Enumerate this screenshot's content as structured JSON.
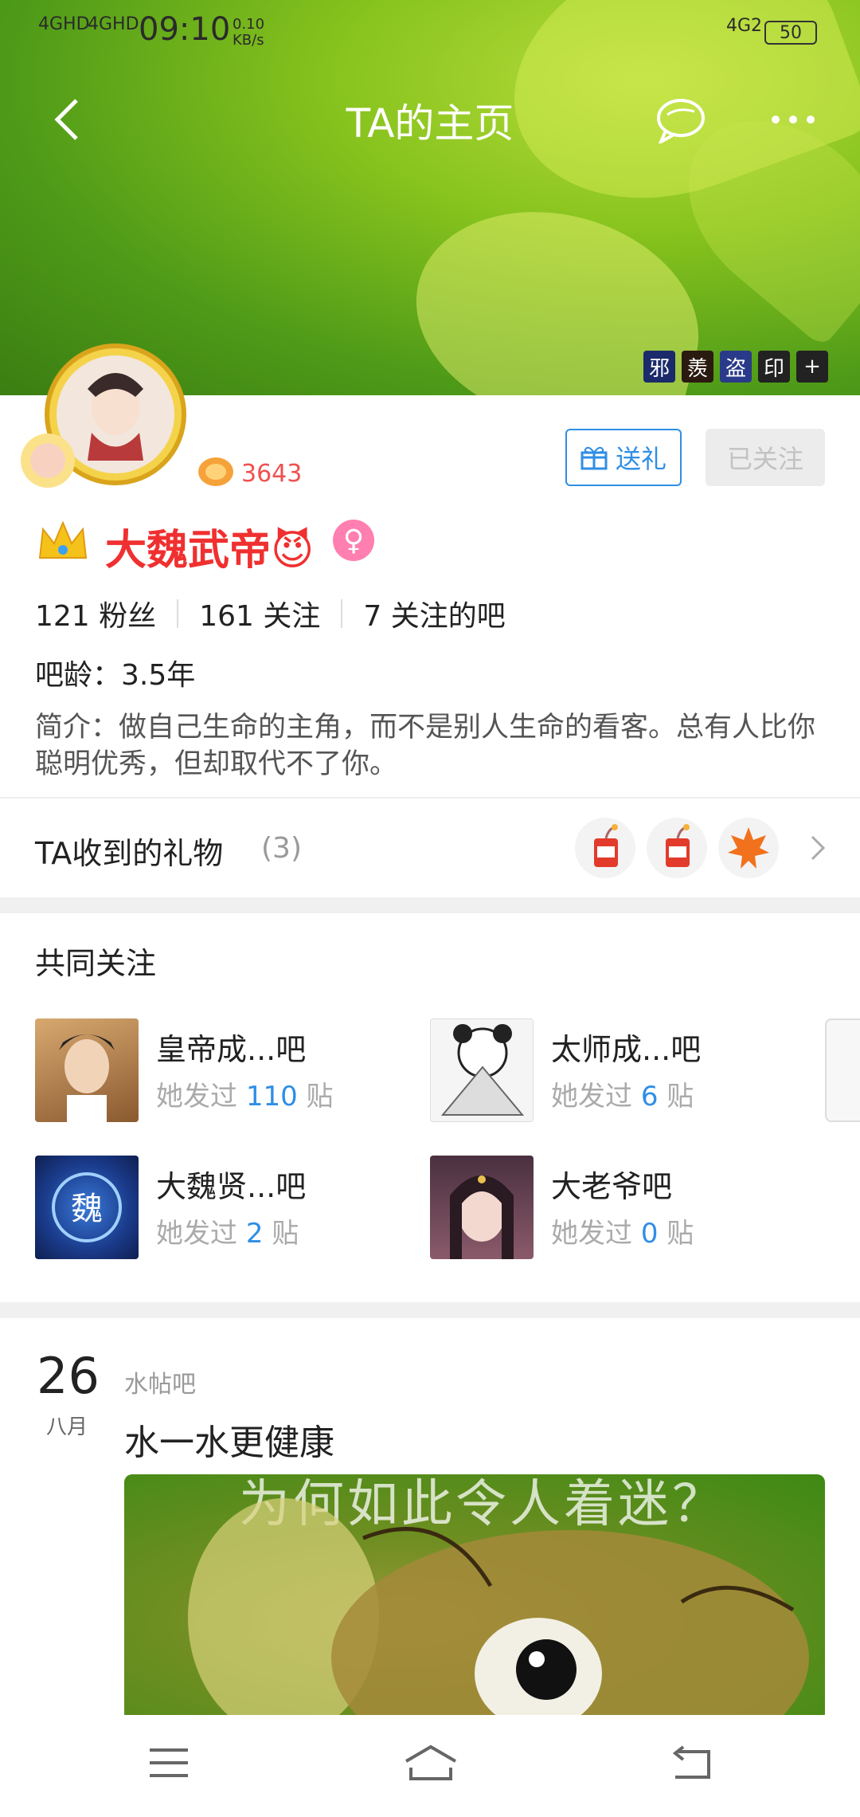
{
  "status_bar": {
    "signal1": "4GHD",
    "signal2": "4GHD",
    "time": "09:10",
    "speed_value": "0.10",
    "speed_unit": "KB/s",
    "net": "4G2",
    "battery": "50"
  },
  "nav": {
    "title": "TA的主页"
  },
  "hero_badges": [
    "邪",
    "羨",
    "盗",
    "印",
    "+"
  ],
  "profile": {
    "level": "3643",
    "username": "大魏武帝😈",
    "gender_icon": "♀",
    "gift_button": "送礼",
    "follow_button": "已关注",
    "stats": [
      {
        "num": "121",
        "label": "粉丝"
      },
      {
        "num": "161",
        "label": "关注"
      },
      {
        "num": "7",
        "label": "关注的吧"
      }
    ],
    "age": "吧龄：3.5年",
    "bio": "简介：做自己生命的主角，而不是别人生命的看客。总有人比你聪明优秀，但却取代不了你。"
  },
  "gifts": {
    "title": "TA收到的礼物",
    "count": "(3)"
  },
  "common": {
    "title": "共同关注",
    "bars": [
      {
        "name": "皇帝成...吧",
        "prefix": "她发过",
        "num": "110",
        "suffix": "贴",
        "color": "#c8a070"
      },
      {
        "name": "太师成...吧",
        "prefix": "她发过",
        "num": "6",
        "suffix": "贴",
        "color": "#dddddd"
      },
      {
        "name": "大魏贤...吧",
        "prefix": "她发过",
        "num": "2",
        "suffix": "贴",
        "color": "#1d3f9a"
      },
      {
        "name": "大老爷吧",
        "prefix": "她发过",
        "num": "0",
        "suffix": "贴",
        "color": "#6a4a56"
      }
    ]
  },
  "post": {
    "day": "26",
    "month": "八月",
    "bar": "水帖吧",
    "title": "水一水更健康",
    "image_caption": "为何如此令人着迷？"
  }
}
